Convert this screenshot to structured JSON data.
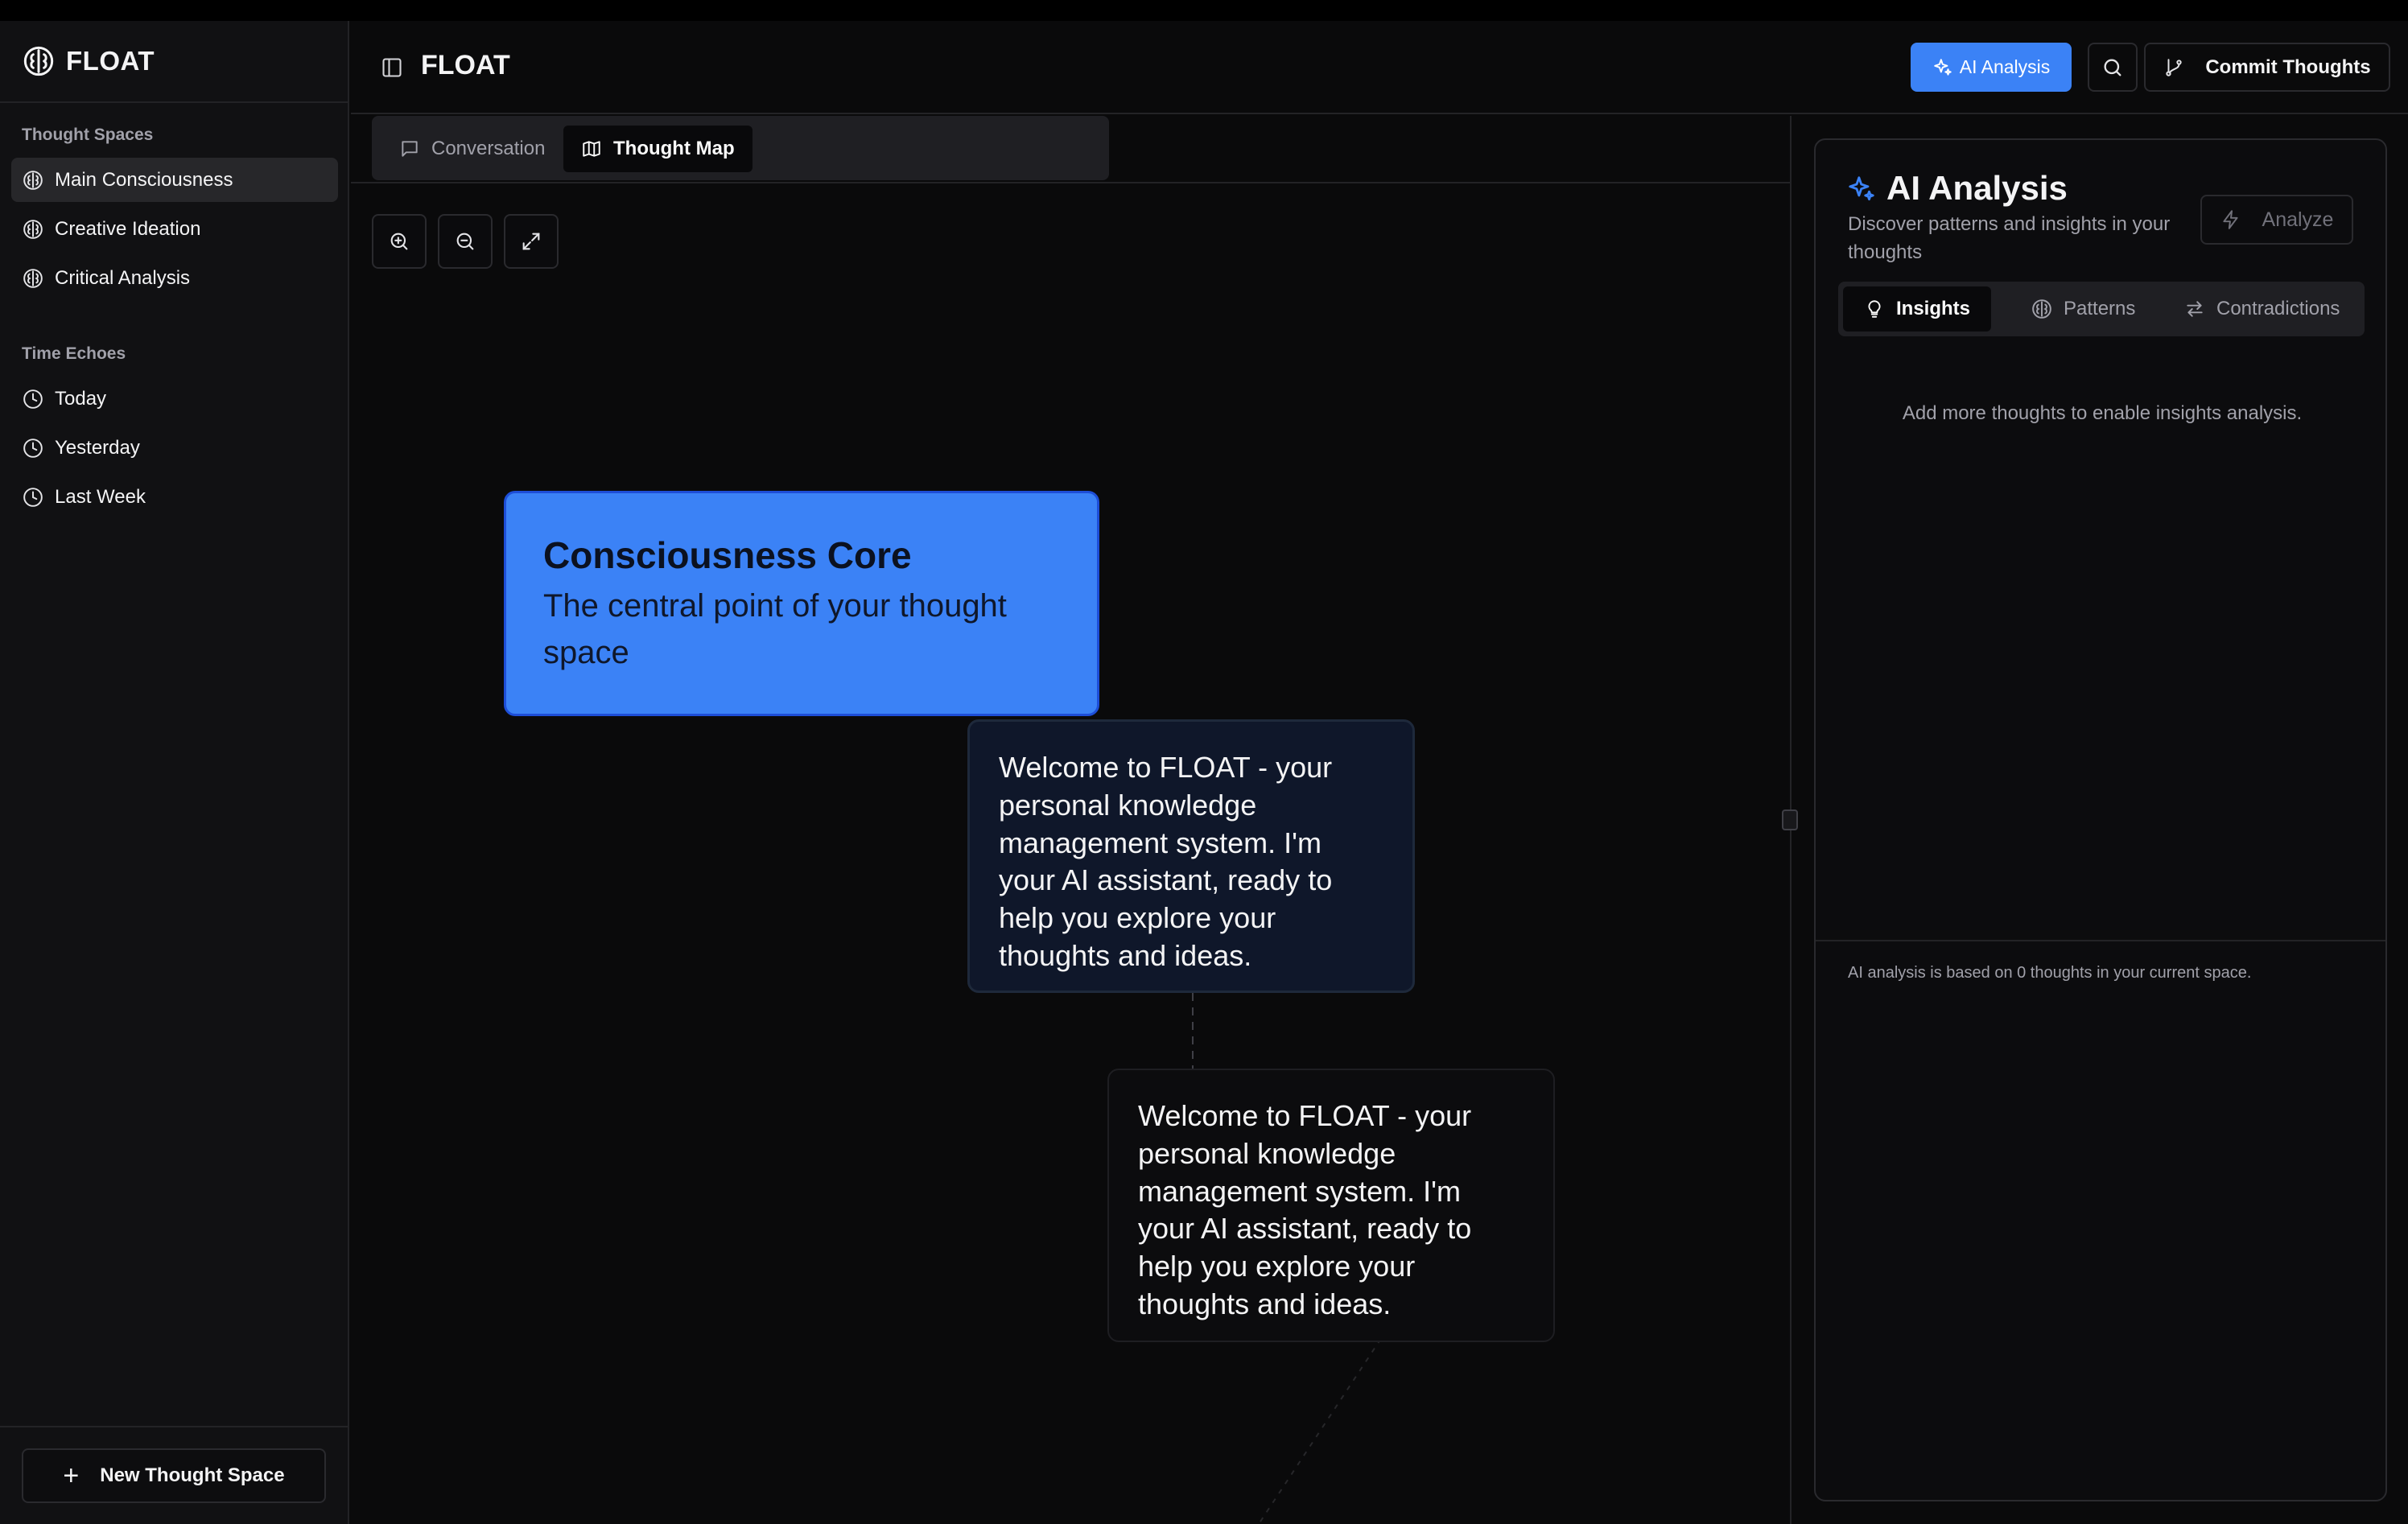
{
  "app": {
    "name": "FLOAT"
  },
  "sidebar": {
    "sections": [
      {
        "label": "Thought Spaces",
        "items": [
          {
            "label": "Main Consciousness",
            "icon": "brain-icon",
            "active": true
          },
          {
            "label": "Creative Ideation",
            "icon": "brain-icon",
            "active": false
          },
          {
            "label": "Critical Analysis",
            "icon": "brain-icon",
            "active": false
          }
        ]
      },
      {
        "label": "Time Echoes",
        "items": [
          {
            "label": "Today",
            "icon": "clock-icon"
          },
          {
            "label": "Yesterday",
            "icon": "clock-icon"
          },
          {
            "label": "Last Week",
            "icon": "clock-icon"
          }
        ]
      }
    ],
    "new_space_label": "New Thought Space"
  },
  "header": {
    "title": "FLOAT",
    "ai_button_label": "AI Analysis",
    "commit_label": "Commit Thoughts"
  },
  "main": {
    "tabs": [
      {
        "label": "Conversation",
        "icon": "message-icon",
        "active": false
      },
      {
        "label": "Thought Map",
        "icon": "map-icon",
        "active": true
      }
    ],
    "map": {
      "core": {
        "title": "Consciousness Core",
        "description": "The central point of your thought space"
      },
      "nodes": [
        {
          "text": "Welcome to FLOAT - your personal knowledge management system. I'm your AI assistant, ready to help you explore your thoughts and ideas."
        },
        {
          "text": "Welcome to FLOAT - your personal knowledge management system. I'm your AI assistant, ready to help you explore your thoughts and ideas."
        }
      ]
    }
  },
  "ai_panel": {
    "title": "AI Analysis",
    "subtitle": "Discover patterns and insights in your thoughts",
    "analyze_label": "Analyze",
    "tabs": [
      {
        "label": "Insights",
        "icon": "lightbulb-icon",
        "active": true
      },
      {
        "label": "Patterns",
        "icon": "brain-icon",
        "active": false
      },
      {
        "label": "Contradictions",
        "icon": "arrows-swap-icon",
        "active": false
      }
    ],
    "empty_text": "Add more thoughts to enable insights analysis.",
    "footer_text": "AI analysis is based on 0 thoughts in your current space."
  },
  "colors": {
    "accent": "#3b82f6",
    "background": "#0a0a0b",
    "sidebar": "#111113"
  }
}
